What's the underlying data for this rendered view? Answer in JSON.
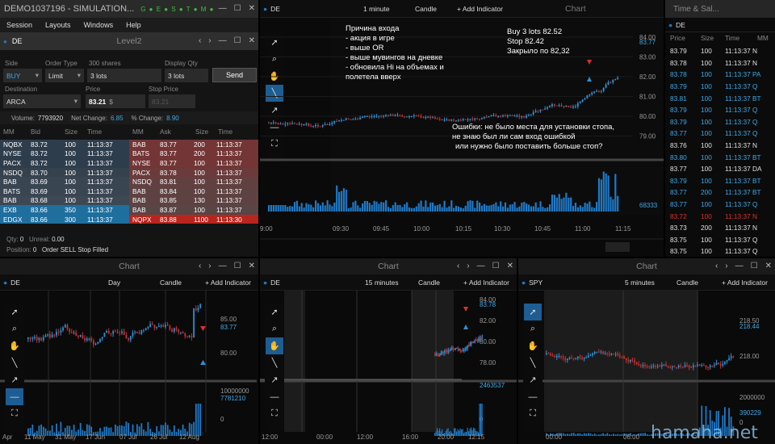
{
  "menu": {
    "items": [
      "Session",
      "Layouts",
      "Windows",
      "Help"
    ]
  },
  "app": {
    "title": "DEMO1037196 - SIMULATION..."
  },
  "level2": {
    "title": "Level2",
    "symbol": "DE",
    "side_label": "Side",
    "side": "BUY",
    "order_type_label": "Order Type",
    "order_type": "Limit",
    "qty_hint": "300 shares",
    "qty": "3 lots",
    "display_label": "Display Qty",
    "display_qty": "3 lots",
    "send": "Send",
    "dest_label": "Destination",
    "destination": "ARCA",
    "price_label": "Price",
    "price": "83.21",
    "price_suffix": "$",
    "stop_label": "Stop Price",
    "stop_price": "83.21",
    "volume_label": "Volume:",
    "volume": "7793920",
    "netchg_label": "Net Change:",
    "netchg": "6.85",
    "pctchg_label": "% Change:",
    "pctchg": "8.90",
    "bid_headers": [
      "MM",
      "Bid",
      "Size",
      "Time"
    ],
    "ask_headers": [
      "MM",
      "Ask",
      "Size",
      "Time"
    ],
    "bids": [
      {
        "mm": "NQBX",
        "price": "83.72",
        "size": "100",
        "time": "11:13:37",
        "color": "#2e3d4c"
      },
      {
        "mm": "NYSE",
        "price": "83.72",
        "size": "100",
        "time": "11:13:37",
        "color": "#2e3d4c"
      },
      {
        "mm": "PACX",
        "price": "83.72",
        "size": "100",
        "time": "11:13:37",
        "color": "#2e3d4c"
      },
      {
        "mm": "NSDQ",
        "price": "83.70",
        "size": "100",
        "time": "11:13:37",
        "color": "#35414d"
      },
      {
        "mm": "BAB",
        "price": "83.69",
        "size": "100",
        "time": "11:13:37",
        "color": "#3a4552"
      },
      {
        "mm": "BATS",
        "price": "83.69",
        "size": "100",
        "time": "11:13:37",
        "color": "#3a4552"
      },
      {
        "mm": "BAB",
        "price": "83.68",
        "size": "100",
        "time": "11:13:37",
        "color": "#3e4854"
      },
      {
        "mm": "EXB",
        "price": "83.66",
        "size": "350",
        "time": "11:13:37",
        "color": "#1f6f9e"
      },
      {
        "mm": "EDGX",
        "price": "83.66",
        "size": "300",
        "time": "11:13:37",
        "color": "#1f6f9e"
      }
    ],
    "asks": [
      {
        "mm": "BAB",
        "price": "83.77",
        "size": "200",
        "time": "11:13:37",
        "color": "#733535"
      },
      {
        "mm": "BATS",
        "price": "83.77",
        "size": "200",
        "time": "11:13:37",
        "color": "#733535"
      },
      {
        "mm": "NYSE",
        "price": "83.77",
        "size": "100",
        "time": "11:13:37",
        "color": "#733535"
      },
      {
        "mm": "PACX",
        "price": "83.78",
        "size": "100",
        "time": "11:13:37",
        "color": "#6b3a3a"
      },
      {
        "mm": "NSDQ",
        "price": "83.81",
        "size": "100",
        "time": "11:13:37",
        "color": "#634040"
      },
      {
        "mm": "BAB",
        "price": "83.84",
        "size": "100",
        "time": "11:13:37",
        "color": "#5e4242"
      },
      {
        "mm": "BAB",
        "price": "83.85",
        "size": "130",
        "time": "11:13:37",
        "color": "#5e4242"
      },
      {
        "mm": "BAB",
        "price": "83.87",
        "size": "100",
        "time": "11:13:37",
        "color": "#584545"
      },
      {
        "mm": "NQPX",
        "price": "83.88",
        "size": "1100",
        "time": "11:13:30",
        "color": "#b8251d"
      }
    ],
    "qty_label": "Qty:",
    "qty_val": "0",
    "unreal_label": "Unreal:",
    "unreal_val": "0.00",
    "position_label": "Position:",
    "position_val": "0",
    "status": "Order SELL Stop Filled"
  },
  "main_chart": {
    "title": "Chart",
    "symbol": "DE",
    "interval": "1 minute",
    "type": "Candle",
    "add": "+ Add Indicator",
    "price_ticks": [
      "84.00",
      "83.00",
      "82.00",
      "81.00",
      "80.00",
      "79.00"
    ],
    "last_price": "83.77",
    "vol_tick": "68333",
    "time_ticks": [
      "9:00",
      "09:30",
      "09:45",
      "10:00",
      "10:15",
      "10:30",
      "10:45",
      "11:00",
      "11:15"
    ],
    "annotation1": [
      "Причина входа",
      "- акция в игре",
      "- выше OR",
      "- выше мувингов на дневке",
      "- обновила Hi на объемах и",
      "полетела вверх"
    ],
    "annotation2": [
      "Buy 3 lots 82.52",
      "Stop 82.42",
      "Закрыло по 82,32"
    ],
    "annotation3": [
      "Ошибки: не было места для установки стопа,",
      "не знаю был ли сам вход ошибкой",
      "или нужно было поставить больше стоп?"
    ]
  },
  "ts": {
    "title": "Time & Sal...",
    "symbol": "DE",
    "headers": [
      "Price",
      "Size",
      "Time",
      "MM"
    ],
    "rows": [
      {
        "p": "83.79",
        "s": "100",
        "t": "11:13:37",
        "m": "N",
        "c": "#e0e0e0"
      },
      {
        "p": "83.78",
        "s": "100",
        "t": "11:13:37",
        "m": "N",
        "c": "#e0e0e0"
      },
      {
        "p": "83.78",
        "s": "100",
        "t": "11:13:37",
        "m": "PA",
        "c": "#3fa9e8"
      },
      {
        "p": "83.79",
        "s": "100",
        "t": "11:13:37",
        "m": "Q",
        "c": "#3fa9e8"
      },
      {
        "p": "83.81",
        "s": "100",
        "t": "11:13:37",
        "m": "BT",
        "c": "#3fa9e8"
      },
      {
        "p": "83.79",
        "s": "100",
        "t": "11:13:37",
        "m": "Q",
        "c": "#3fa9e8"
      },
      {
        "p": "83.79",
        "s": "100",
        "t": "11:13:37",
        "m": "Q",
        "c": "#3fa9e8"
      },
      {
        "p": "83.77",
        "s": "100",
        "t": "11:13:37",
        "m": "Q",
        "c": "#3fa9e8"
      },
      {
        "p": "83.76",
        "s": "100",
        "t": "11:13:37",
        "m": "N",
        "c": "#e0e0e0"
      },
      {
        "p": "83.80",
        "s": "100",
        "t": "11:13:37",
        "m": "BT",
        "c": "#3fa9e8"
      },
      {
        "p": "83.77",
        "s": "100",
        "t": "11:13:37",
        "m": "DA",
        "c": "#e0e0e0"
      },
      {
        "p": "83.79",
        "s": "100",
        "t": "11:13:37",
        "m": "BT",
        "c": "#3fa9e8"
      },
      {
        "p": "83.77",
        "s": "200",
        "t": "11:13:37",
        "m": "BT",
        "c": "#3fa9e8"
      },
      {
        "p": "83.77",
        "s": "100",
        "t": "11:13:37",
        "m": "Q",
        "c": "#3fa9e8"
      },
      {
        "p": "83.72",
        "s": "100",
        "t": "11:13:37",
        "m": "N",
        "c": "#d9322b"
      },
      {
        "p": "83.73",
        "s": "200",
        "t": "11:13:37",
        "m": "N",
        "c": "#e0e0e0"
      },
      {
        "p": "83.75",
        "s": "100",
        "t": "11:13:37",
        "m": "Q",
        "c": "#e0e0e0"
      },
      {
        "p": "83.75",
        "s": "100",
        "t": "11:13:37",
        "m": "Q",
        "c": "#e0e0e0"
      }
    ]
  },
  "chart_day": {
    "title": "Chart",
    "symbol": "DE",
    "interval": "Day",
    "type": "Candle",
    "add": "+ Add Indicator",
    "price_ticks": [
      "85.00",
      "80.00"
    ],
    "last_price": "83.77",
    "vol_ticks": [
      "10000000",
      "7781210",
      "0"
    ],
    "time_ticks": [
      "Apr",
      "11 May",
      "31 May",
      "17 Jun",
      "07 Jul",
      "26 Jul",
      "12 Aug"
    ]
  },
  "chart_15": {
    "title": "Chart",
    "symbol": "DE",
    "interval": "15 minutes",
    "type": "Candle",
    "add": "+ Add Indicator",
    "price_ticks": [
      "84.00",
      "82.00",
      "80.00",
      "78.00"
    ],
    "last_price": "83.78",
    "vol_ticks": [
      "2463537",
      "0"
    ],
    "time_ticks": [
      "12:00",
      "00:00",
      "12:00",
      "16:00",
      "20:00",
      "12:15"
    ]
  },
  "chart_spy": {
    "title": "Chart",
    "symbol": "SPY",
    "interval": "5 minutes",
    "type": "Candle",
    "add": "+ Add Indicator",
    "price_ticks": [
      "218.50",
      "218.00"
    ],
    "last_price": "218.44",
    "vol_ticks": [
      "2000000",
      "390229",
      "0"
    ],
    "time_ticks": [
      "00:00",
      "06:00"
    ]
  },
  "watermark": "hamaha.net"
}
